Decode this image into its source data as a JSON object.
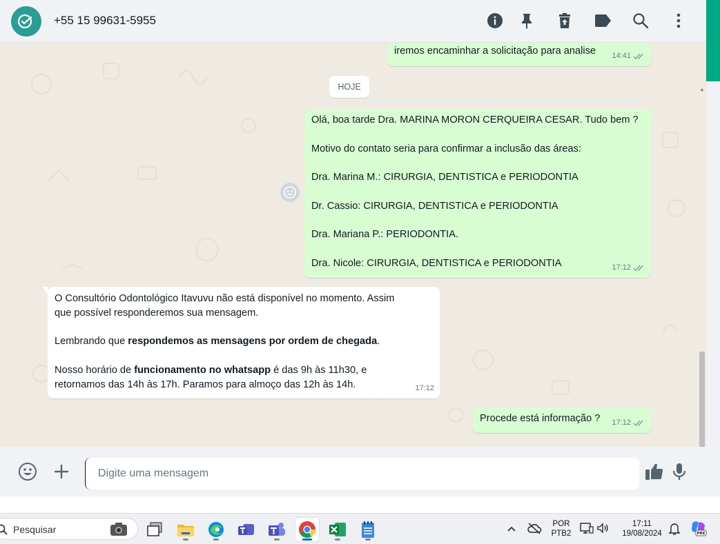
{
  "header": {
    "contact_name": "+55 15 99631-5955",
    "icons": [
      "info-icon",
      "pin-icon",
      "delete-icon",
      "label-icon",
      "search-icon",
      "menu-icon"
    ]
  },
  "colors": {
    "outgoing_bubble": "#d9fdd3",
    "incoming_bubble": "#ffffff",
    "accent": "#00a884",
    "avatar": "#2a9d96",
    "chat_bg": "#efeae2"
  },
  "chat": {
    "date_chip": "HOJE",
    "messages": [
      {
        "direction": "out",
        "lines": [
          "iremos encaminhar a solicitação para analise"
        ],
        "time": "14:41"
      },
      {
        "direction": "out",
        "lines": [
          "Olá, boa tarde Dra. MARINA MORON CERQUEIRA CESAR. Tudo bem ?",
          "",
          "Motivo do contato seria para confirmar a inclusão das áreas:",
          "",
          "Dra. Marina M.: CIRURGIA, DENTISTICA e PERIODONTIA",
          "",
          "Dr. Cassio: CIRURGIA, DENTISTICA e PERIODONTIA",
          "",
          "Dra. Mariana P.: PERIODONTIA.",
          "",
          "Dra. Nicole: CIRURGIA, DENTISTICA e PERIODONTIA"
        ],
        "time": "17:12"
      },
      {
        "direction": "in",
        "p1_l1": "O Consultório Odontológico Itavuvu não está disponível no momento. Assim",
        "p1_l2": "que possível responderemos sua mensagem.",
        "p2_pre": "Lembrando que ",
        "p2_bold": "respondemos as mensagens por ordem de chegada",
        "p2_post": ".",
        "p3_pre": "Nosso horário de ",
        "p3_bold": "funcionamento no whatsapp",
        "p3_post": " é das 9h às 11h30, e",
        "p3_l2": "retornamos das 14h às 17h. Paramos para almoço das 12h às 14h.",
        "time": "17:12"
      },
      {
        "direction": "out",
        "lines": [
          "Procede está informação ?"
        ],
        "time": "17:12"
      }
    ]
  },
  "composer": {
    "placeholder": "Digite uma mensagem"
  },
  "taskbar": {
    "search_label": "Pesquisar",
    "language_line1": "POR",
    "language_line2": "PTB2",
    "time": "17:11",
    "date": "19/08/2024"
  }
}
